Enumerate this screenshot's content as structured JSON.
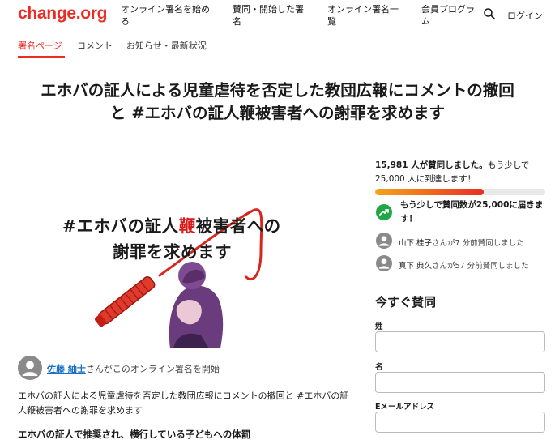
{
  "header": {
    "logo": "change.org",
    "nav": [
      {
        "line1": "オンライン署名を始め",
        "line2": "る"
      },
      {
        "line1": "賛同・開始した署",
        "line2": "名"
      },
      {
        "line1": "オンライン署名一",
        "line2": "覧"
      },
      {
        "line1": "会員プログラ",
        "line2": "ム"
      }
    ],
    "search_icon": "search-icon",
    "login": "ログイン"
  },
  "tabs": [
    {
      "label": "署名ページ",
      "active": true
    },
    {
      "label": "コメント",
      "active": false
    },
    {
      "label": "お知らせ・最新状況",
      "active": false
    }
  ],
  "petition": {
    "title_line1": "エホバの証人による児童虐待を否定した教団広報にコメントの撤回",
    "title_line2": "と #エホバの証人鞭被害者への謝罪を求めます",
    "image": {
      "line1_prefix": "#エホバの証人",
      "line1_highlight": "鞭",
      "line1_suffix": "被害者への",
      "line2": "謝罪を求めます"
    },
    "starter_name": "佐藤 紬士",
    "starter_suffix": "さんがこのオンライン署名を開始",
    "description": "エホバの証人による児童虐待を否定した教団広報にコメントの撤回と #エホバの証人鞭被害者への謝罪を求めます",
    "subheading": "エホバの証人で推奨され、横行している子どもへの体罰"
  },
  "sidebar": {
    "count_bold": "15,981 人が賛同しました。",
    "count_rest_1": "もう少しで",
    "count_rest_2": "25,000 人に到達します！",
    "signatures": 15981,
    "goal": 25000,
    "goal_message": "もう少しで賛同数が25,000に届きます！",
    "activity": [
      {
        "name": "山下 桂子",
        "text": "さんが7 分前賛同しました"
      },
      {
        "name": "真下 典久",
        "text": "さんが57 分前賛同しました"
      }
    ],
    "sign_heading": "今すぐ賛同",
    "fields": [
      {
        "label": "姓",
        "value": ""
      },
      {
        "label": "名",
        "value": ""
      },
      {
        "label": "Eメールアドレス",
        "value": ""
      }
    ]
  },
  "colors": {
    "brand": "#ec2c22",
    "success": "#20a745",
    "link": "#1a6fc2"
  }
}
